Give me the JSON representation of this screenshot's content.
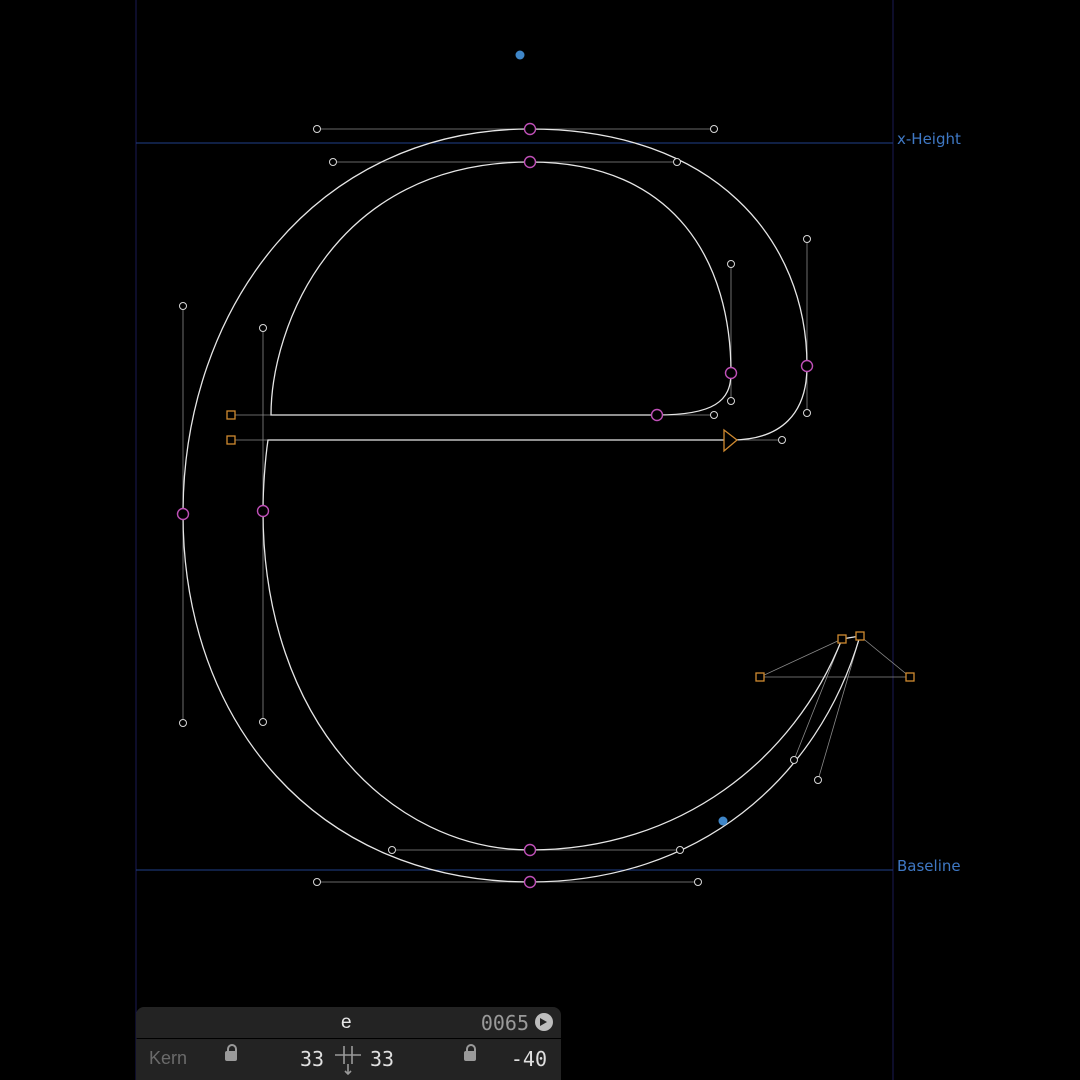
{
  "guides": {
    "x_height_label": "x-Height",
    "baseline_label": "Baseline"
  },
  "glyph_info": {
    "character": "e",
    "unicode": "0065"
  },
  "metrics": {
    "kern_label": "Kern",
    "left_sidebearing": "33",
    "right_sidebearing": "33",
    "kern_value": "-40"
  },
  "colors": {
    "background": "#000000",
    "guide_line": "#1f3f8a",
    "guide_label": "#3f78c4",
    "outline": "#e6e6e6",
    "smooth_node": "#c050b8",
    "corner_node": "#d08a30",
    "handle": "#d8d8d8",
    "anchor": "#3f86c8",
    "panel": "#232323"
  }
}
